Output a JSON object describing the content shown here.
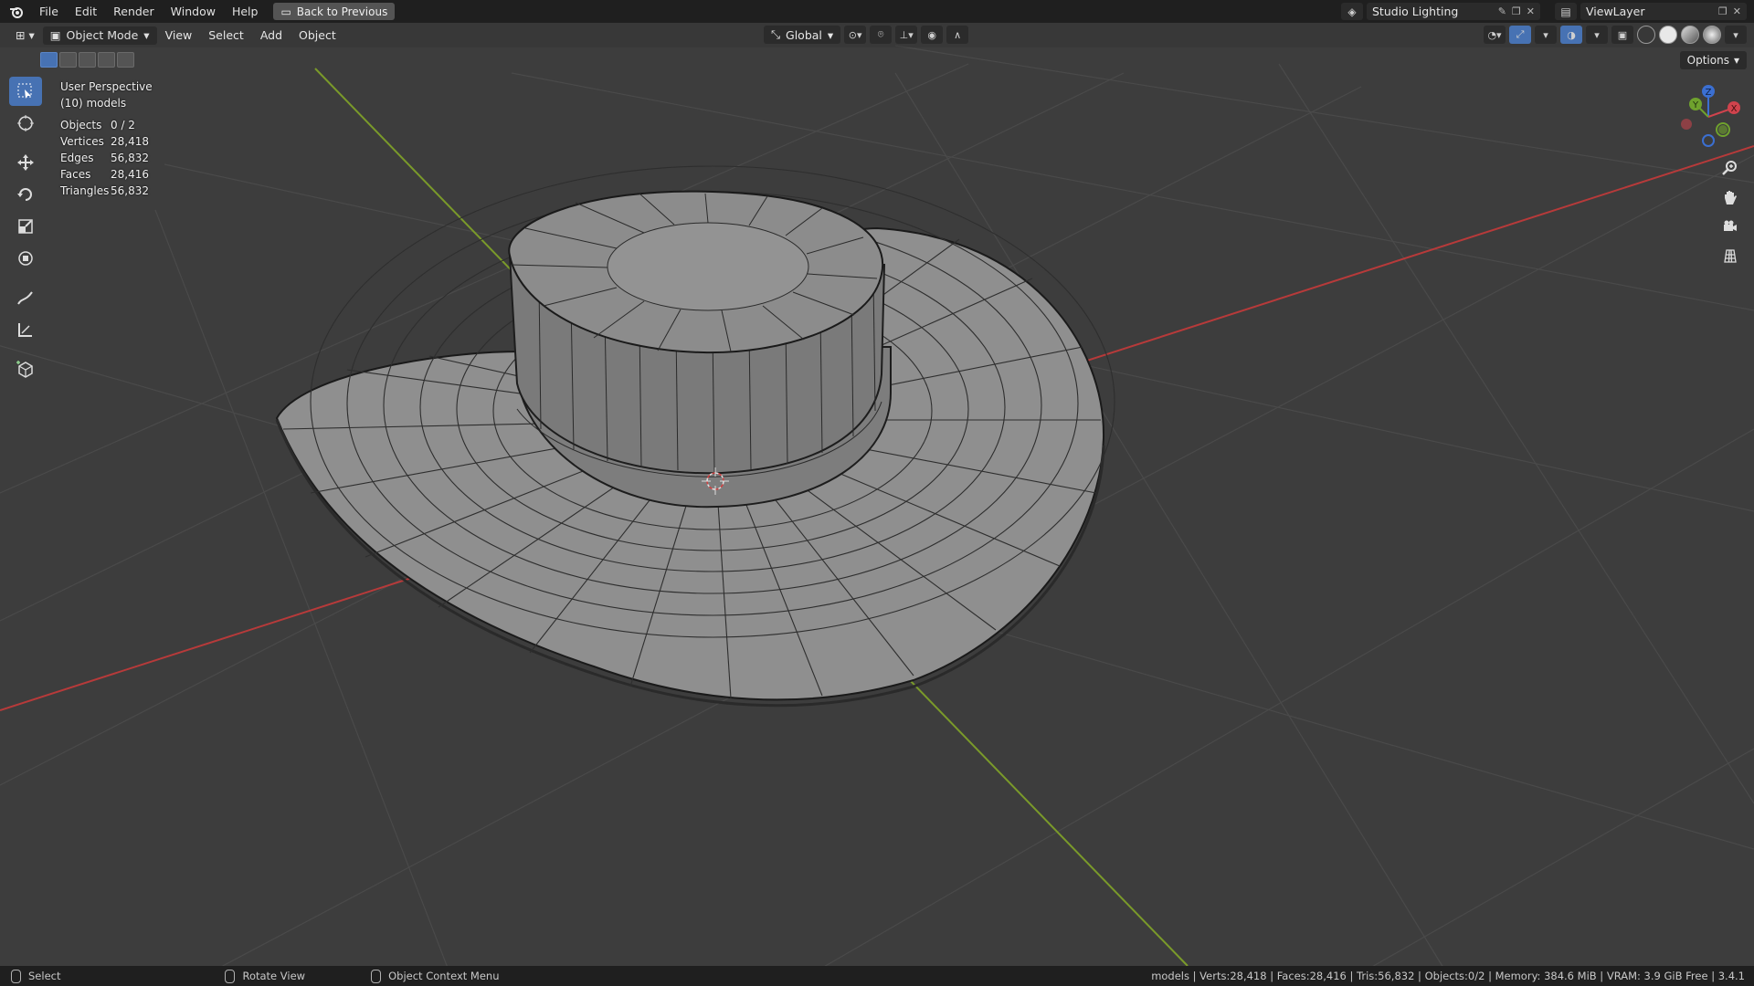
{
  "menu": {
    "items": [
      "File",
      "Edit",
      "Render",
      "Window",
      "Help"
    ],
    "back_button": "Back to Previous"
  },
  "topright": {
    "scene_name": "Studio Lighting",
    "view_layer": "ViewLayer"
  },
  "viewport_header": {
    "mode": "Object Mode",
    "menus": [
      "View",
      "Select",
      "Add",
      "Object"
    ],
    "orientation": "Global",
    "options": "Options"
  },
  "overlay": {
    "view_name": "User Perspective",
    "collection": "(10) models",
    "stats": [
      {
        "label": "Objects",
        "value": "0 / 2"
      },
      {
        "label": "Vertices",
        "value": "28,418"
      },
      {
        "label": "Edges",
        "value": "56,832"
      },
      {
        "label": "Faces",
        "value": "28,416"
      },
      {
        "label": "Triangles",
        "value": "56,832"
      }
    ]
  },
  "gizmo": {
    "x": "X",
    "y": "Y",
    "z": "Z"
  },
  "statusbar": {
    "hints": [
      "Select",
      "Rotate View",
      "Object Context Menu"
    ],
    "info": "models | Verts:28,418 | Faces:28,416 | Tris:56,832 | Objects:0/2 | Memory: 384.6 MiB | VRAM: 3.9 GiB Free | 3.4.1"
  },
  "colors": {
    "viewport_bg": "#3d3d3d",
    "axis_x": "#b73a3a",
    "axis_y": "#7a9a2a",
    "accent": "#4772b3"
  }
}
